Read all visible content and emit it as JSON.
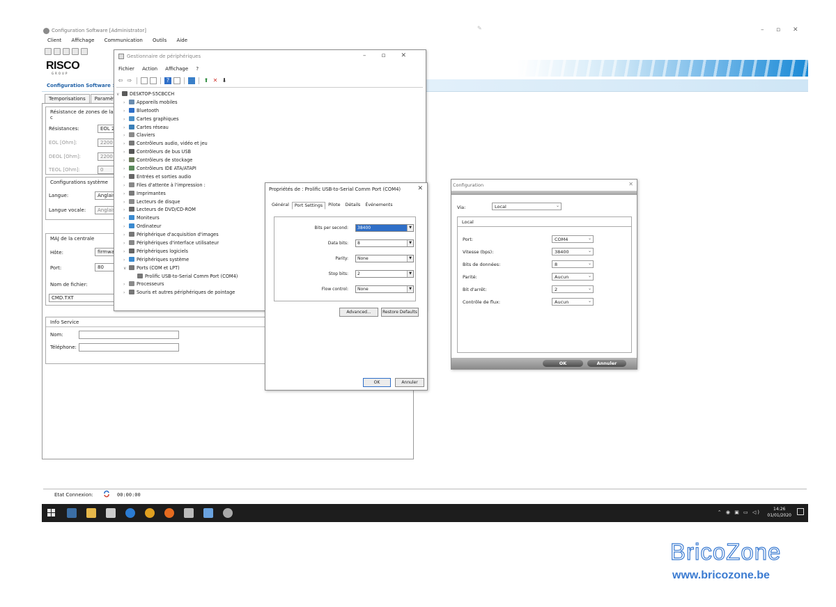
{
  "main_window": {
    "title": "Configuration Software  [Administrator]",
    "menu": [
      "Client",
      "Affichage",
      "Communication",
      "Outils",
      "Aide"
    ],
    "logo": "RISCO",
    "logo_sub": "GROUP",
    "breadcrumb": "Configuration Software >",
    "tabs": [
      "Temporisations",
      "Paramètr"
    ],
    "eol_section": {
      "header": "Résistance de zones de la c",
      "resistances_label": "Résistances:",
      "resistances_value": "EOL 2,2",
      "eol_label": "EOL [Ohm]:",
      "eol_value": "2200",
      "deol_label": "DEOL [Ohm]:",
      "deol_value": "2200",
      "teol_label": "TEOL [Ohm]:",
      "teol_value": "0"
    },
    "system_section": {
      "header": "Configurations système",
      "langue_label": "Langue:",
      "langue_value": "Anglais",
      "langue_vocale_label": "Langue vocale:",
      "langue_vocale_value": "Anglais"
    },
    "maj_section": {
      "header": "MAJ de la centrale",
      "hote_label": "Hôte:",
      "hote_value": "firmware",
      "port_label": "Port:",
      "port_value": "80",
      "nom_fichier_label": "Nom de fichier:",
      "nom_fichier_value": "CMD.TXT"
    },
    "info_section": {
      "header": "Info Service",
      "nom_label": "Nom:",
      "nom_value": "",
      "telephone_label": "Téléphone:",
      "telephone_value": ""
    },
    "status": {
      "label": "Etat Connexion:",
      "time": "00:00:00"
    }
  },
  "device_manager": {
    "title": "Gestionnaire de périphériques",
    "menu": [
      "Fichier",
      "Action",
      "Affichage",
      "?"
    ],
    "root": "DESKTOP-S5CBCCH",
    "items": [
      {
        "label": "Appareils mobiles",
        "icon": "phone-icon",
        "color": "#6a8caf"
      },
      {
        "label": "Bluetooth",
        "icon": "bluetooth-icon",
        "color": "#2f6fc8"
      },
      {
        "label": "Cartes graphiques",
        "icon": "display-adapter-icon",
        "color": "#4a90c8"
      },
      {
        "label": "Cartes réseau",
        "icon": "network-icon",
        "color": "#3a7fb8"
      },
      {
        "label": "Claviers",
        "icon": "keyboard-icon",
        "color": "#8a8a8a"
      },
      {
        "label": "Contrôleurs audio, vidéo et jeu",
        "icon": "audio-icon",
        "color": "#777777"
      },
      {
        "label": "Contrôleurs de bus USB",
        "icon": "usb-icon",
        "color": "#555555"
      },
      {
        "label": "Contrôleurs de stockage",
        "icon": "storage-icon",
        "color": "#6a7a5a"
      },
      {
        "label": "Contrôleurs IDE ATA/ATAPI",
        "icon": "ide-icon",
        "color": "#5a8a5a"
      },
      {
        "label": "Entrées et sorties audio",
        "icon": "speaker-icon",
        "color": "#666666"
      },
      {
        "label": "Files d'attente à l'impression :",
        "icon": "print-queue-icon",
        "color": "#888888"
      },
      {
        "label": "Imprimantes",
        "icon": "printer-icon",
        "color": "#7a7a7a"
      },
      {
        "label": "Lecteurs de disque",
        "icon": "disk-icon",
        "color": "#8a8a8a"
      },
      {
        "label": "Lecteurs de DVD/CD-ROM",
        "icon": "dvd-icon",
        "color": "#666666"
      },
      {
        "label": "Moniteurs",
        "icon": "monitor-icon",
        "color": "#3a8ad0"
      },
      {
        "label": "Ordinateur",
        "icon": "computer-icon",
        "color": "#3a8ad0"
      },
      {
        "label": "Périphérique d'acquisition d'images",
        "icon": "camera-icon",
        "color": "#777777"
      },
      {
        "label": "Périphériques d'interface utilisateur",
        "icon": "hid-icon",
        "color": "#888888"
      },
      {
        "label": "Périphériques logiciels",
        "icon": "software-device-icon",
        "color": "#666666"
      },
      {
        "label": "Périphériques système",
        "icon": "system-device-icon",
        "color": "#3a8ad0"
      },
      {
        "label": "Ports (COM et LPT)",
        "icon": "port-icon",
        "color": "#777777",
        "expanded": true
      },
      {
        "label": "Prolific USB-to-Serial Comm Port (COM4)",
        "icon": "serial-port-icon",
        "color": "#777777",
        "child": true
      },
      {
        "label": "Processeurs",
        "icon": "cpu-icon",
        "color": "#8a8a8a"
      },
      {
        "label": "Souris et autres périphériques de pointage",
        "icon": "mouse-icon",
        "color": "#777777"
      }
    ]
  },
  "properties_dialog": {
    "title": "Propriétés de : Prolific USB-to-Serial Comm Port (COM4)",
    "tabs": [
      "Général",
      "Port Settings",
      "Pilote",
      "Détails",
      "Événements"
    ],
    "active_tab": "Port Settings",
    "fields": [
      {
        "label": "Bits per second:",
        "value": "38400",
        "highlight": true
      },
      {
        "label": "Data bits:",
        "value": "8"
      },
      {
        "label": "Parity:",
        "value": "None"
      },
      {
        "label": "Stop bits:",
        "value": "2"
      },
      {
        "label": "Flow control:",
        "value": "None"
      }
    ],
    "advanced_button": "Advanced...",
    "restore_button": "Restore Defaults",
    "ok_button": "OK",
    "cancel_button": "Annuler"
  },
  "config_dialog": {
    "title": "Configuration",
    "via_label": "Via:",
    "via_value": "Local",
    "local_header": "Local",
    "fields": [
      {
        "label": "Port:",
        "value": "COM4"
      },
      {
        "label": "Vitesse (bps):",
        "value": "38400"
      },
      {
        "label": "Bits de données:",
        "value": "8"
      },
      {
        "label": "Parité:",
        "value": "Aucun"
      },
      {
        "label": "Bit d'arrêt:",
        "value": "2"
      },
      {
        "label": "Contrôle de flux:",
        "value": "Aucun"
      }
    ],
    "ok_button": "OK",
    "cancel_button": "Annuler"
  },
  "taskbar": {
    "time": "14:26",
    "date": "01/01/2020",
    "apps": [
      {
        "name": "task-view-icon",
        "color": "#3b6ea5"
      },
      {
        "name": "file-explorer-icon",
        "color": "#e7b84a"
      },
      {
        "name": "calendar-icon",
        "color": "#cccccc"
      },
      {
        "name": "edge-icon",
        "color": "#2b7cd3"
      },
      {
        "name": "chrome-icon",
        "color": "#e0a020"
      },
      {
        "name": "firefox-icon",
        "color": "#e66b1f"
      },
      {
        "name": "printer-app-icon",
        "color": "#bbbbbb"
      },
      {
        "name": "config-app-icon",
        "color": "#6aa3e0"
      },
      {
        "name": "risco-app-icon",
        "color": "#aaaaaa"
      }
    ]
  },
  "watermark": {
    "title": "BricoZone",
    "url": "www.bricozone.be"
  }
}
